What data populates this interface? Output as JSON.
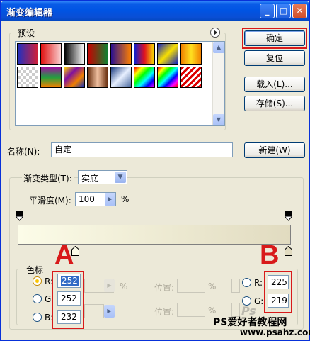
{
  "window": {
    "title": "渐变编辑器",
    "controls": {
      "minimize": "_",
      "maximize": "□",
      "close": "✕"
    }
  },
  "presets": {
    "label": "预设",
    "menu_icon": "triangle-right-icon",
    "swatches": [
      {
        "name": "blue-red",
        "gradient": "linear-gradient(to right, #2030c0, #d0203a)"
      },
      {
        "name": "red-transparent",
        "gradient": "linear-gradient(to right, #e01010, rgba(224,16,16,0.2))"
      },
      {
        "name": "black-white",
        "gradient": "linear-gradient(to right, #000, #fff)"
      },
      {
        "name": "red-green",
        "gradient": "linear-gradient(to right, #c80000, #108030)"
      },
      {
        "name": "violet-orange",
        "gradient": "linear-gradient(to right, #2a1090, #ff8000)"
      },
      {
        "name": "blue-red-yellow",
        "gradient": "linear-gradient(to right, #1020d0, #e01020, #f8e000)"
      },
      {
        "name": "blue-yellow-blue",
        "gradient": "linear-gradient(135deg, #1020c0, #f8e000, #1020c0)"
      },
      {
        "name": "orange-yellow-orange",
        "gradient": "linear-gradient(to right, #f08000, #ffe020, #f08000)"
      },
      {
        "name": "checker-transparent",
        "gradient": "repeating-conic-gradient(#ccc 0 25%, #fff 0 50%) 0 0/8px 8px"
      },
      {
        "name": "violet-green-orange",
        "gradient": "linear-gradient(to bottom, #a010a0, #20a040, #f08000)"
      },
      {
        "name": "yellow-violet-orange-blue",
        "gradient": "linear-gradient(135deg, #f8d000, #8010a0, #f08000, #1030c0)"
      },
      {
        "name": "copper",
        "gradient": "linear-gradient(to right, #6a3010, #f0c0a0, #6a3010)"
      },
      {
        "name": "chrome",
        "gradient": "linear-gradient(135deg, #1a3a80, #e8f0ff, #4a6aa0)"
      },
      {
        "name": "spectrum",
        "gradient": "linear-gradient(135deg, #f00, #ff0, #0f0, #0ff, #00f, #f0f)"
      },
      {
        "name": "transparent-rainbow",
        "gradient": "linear-gradient(135deg, #f00, #ff0, #0f0, #0ff, #00f, #f0f, #f00)"
      },
      {
        "name": "transparent-stripes",
        "gradient": "repeating-linear-gradient(135deg, #d00 0 3px, #fff 3px 6px)"
      }
    ]
  },
  "buttons": {
    "ok": "确定",
    "reset": "复位",
    "load": "载入(L)...",
    "save": "存储(S)...",
    "new": "新建(W)"
  },
  "name_field": {
    "label": "名称(N):",
    "value": "自定"
  },
  "gradient": {
    "group_label": "渐变类型(T):",
    "type_value": "实底",
    "smoothness_label": "平滑度(M):",
    "smoothness_value": "100",
    "smoothness_unit": "%",
    "stop_colors": {
      "left": "#fcfce8",
      "right": "#e1dbc0"
    }
  },
  "color_stops": {
    "group_label": "色标",
    "left": {
      "r_label": "R:",
      "r": "252",
      "g_label": "G:",
      "g": "252",
      "b_label": "B:",
      "b": "232"
    },
    "right": {
      "r_label": "R:",
      "r": "225",
      "g_label": "G:",
      "g": "219"
    },
    "location_label_1": "位置:",
    "location_label_2": "位置:",
    "percent": "%"
  },
  "annotations": {
    "letter_a": "A",
    "letter_b": "B"
  },
  "watermark": {
    "site_cn": "PS爱好者教程网",
    "site_url": "www.psahz.com",
    "ps_mark": "Ps"
  }
}
